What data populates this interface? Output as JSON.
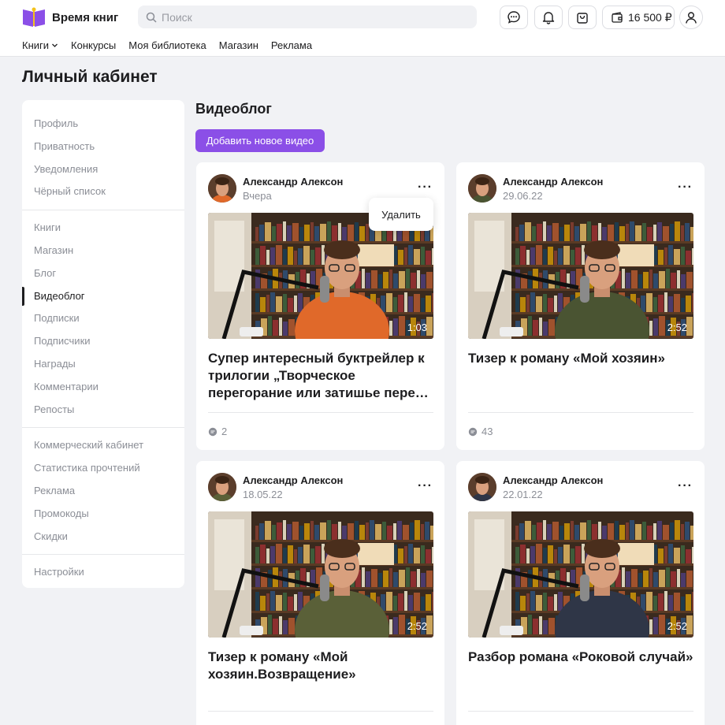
{
  "app": {
    "name": "Время книг"
  },
  "search": {
    "placeholder": "Поиск"
  },
  "header": {
    "balance": "16 500 ₽"
  },
  "nav": [
    "Книги",
    "Конкурсы",
    "Моя библиотека",
    "Магазин",
    "Реклама"
  ],
  "page": {
    "title": "Личный кабинет"
  },
  "sidebar": {
    "groups": [
      [
        "Профиль",
        "Приватность",
        "Уведомления",
        "Чёрный список"
      ],
      [
        "Книги",
        "Магазин",
        "Блог",
        "Видеоблог",
        "Подписки",
        "Подписчики",
        "Награды",
        "Комментарии",
        "Репосты"
      ],
      [
        "Коммерческий кабинет",
        "Статистика прочтений",
        "Реклама",
        "Промокоды",
        "Скидки"
      ],
      [
        "Настройки"
      ]
    ],
    "active": "Видеоблог"
  },
  "section": {
    "title": "Видеоблог",
    "add_button": "Добавить новое видео"
  },
  "popover": {
    "label": "Удалить"
  },
  "videos": [
    {
      "author": "Александр Алексон",
      "date": "Вчера",
      "duration": "1:03",
      "title": "Супер интересный буктрейлер к трилогии „Творческое перегорание или затишье перед бурей“",
      "comments": "2",
      "shirt": "#e0692a"
    },
    {
      "author": "Александр Алексон",
      "date": "29.06.22",
      "duration": "2:52",
      "title": "Тизер к роману «Мой хозяин»",
      "comments": "43",
      "shirt": "#4a5432"
    },
    {
      "author": "Александр Алексон",
      "date": "18.05.22",
      "duration": "2:52",
      "title": "Тизер к роману «Мой хозяин.Возвращение»",
      "comments": "",
      "shirt": "#5a6038"
    },
    {
      "author": "Александр Алексон",
      "date": "22.01.22",
      "duration": "2:52",
      "title": "Разбор романа «Роковой случай»",
      "comments": "",
      "shirt": "#2f3647"
    }
  ]
}
